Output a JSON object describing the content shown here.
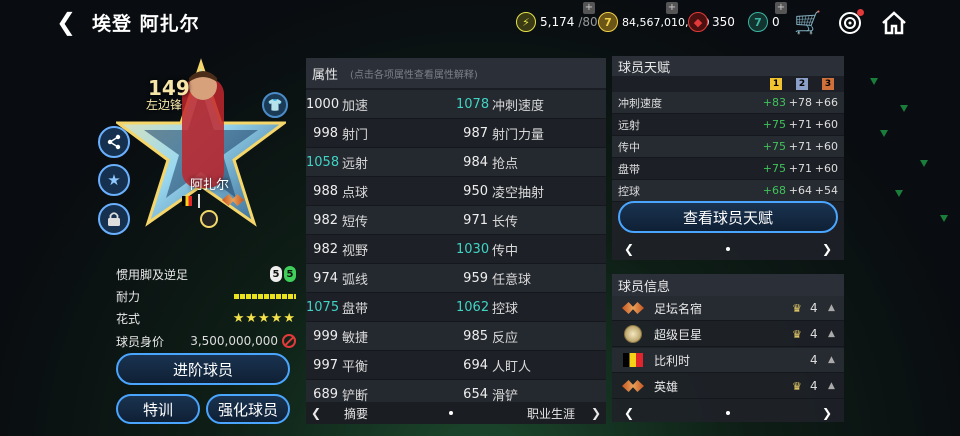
{
  "header": {
    "title": "埃登 阿扎尔",
    "resources": [
      {
        "icon": "energy-icon",
        "value": "5,174",
        "max": "/80",
        "color": "#d6d334"
      },
      {
        "icon": "coin-icon",
        "value": "84,567,010,400",
        "color": "#d8b23a"
      },
      {
        "icon": "gem-icon",
        "value": "350",
        "color": "#d43a3a"
      },
      {
        "icon": "token-icon",
        "value": "0",
        "color": "#3cb4a3"
      }
    ]
  },
  "card": {
    "rating": "149",
    "position": "左边锋",
    "name": "阿扎尔"
  },
  "player_stats": {
    "foot_label": "惯用脚及逆足",
    "foot_left": "5",
    "foot_right": "5",
    "stamina_label": "耐力",
    "skill_label": "花式",
    "skill_stars": "★★★★★",
    "value_label": "球员身价",
    "value": "3,500,000,000"
  },
  "buttons": {
    "advance": "进阶球员",
    "train": "特训",
    "enhance": "强化球员"
  },
  "attributes": {
    "title": "属性",
    "hint": "(点击各项属性查看属性解释)",
    "rows": [
      [
        {
          "v": "1000",
          "n": "加速",
          "hl": false
        },
        {
          "v": "1078",
          "n": "冲刺速度",
          "hl": true
        }
      ],
      [
        {
          "v": "998",
          "n": "射门",
          "hl": false
        },
        {
          "v": "987",
          "n": "射门力量",
          "hl": false
        }
      ],
      [
        {
          "v": "1058",
          "n": "远射",
          "hl": true
        },
        {
          "v": "984",
          "n": "抢点",
          "hl": false
        }
      ],
      [
        {
          "v": "988",
          "n": "点球",
          "hl": false
        },
        {
          "v": "950",
          "n": "凌空抽射",
          "hl": false
        }
      ],
      [
        {
          "v": "982",
          "n": "短传",
          "hl": false
        },
        {
          "v": "971",
          "n": "长传",
          "hl": false
        }
      ],
      [
        {
          "v": "982",
          "n": "视野",
          "hl": false
        },
        {
          "v": "1030",
          "n": "传中",
          "hl": true
        }
      ],
      [
        {
          "v": "974",
          "n": "弧线",
          "hl": false
        },
        {
          "v": "959",
          "n": "任意球",
          "hl": false
        }
      ],
      [
        {
          "v": "1075",
          "n": "盘带",
          "hl": true
        },
        {
          "v": "1062",
          "n": "控球",
          "hl": true
        }
      ],
      [
        {
          "v": "999",
          "n": "敏捷",
          "hl": false
        },
        {
          "v": "985",
          "n": "反应",
          "hl": false
        }
      ],
      [
        {
          "v": "997",
          "n": "平衡",
          "hl": false
        },
        {
          "v": "694",
          "n": "人盯人",
          "hl": false
        }
      ],
      [
        {
          "v": "689",
          "n": "铲断",
          "hl": false
        },
        {
          "v": "654",
          "n": "滑铲",
          "hl": false
        }
      ]
    ],
    "footer_left": "摘要",
    "footer_right": "职业生涯"
  },
  "talent": {
    "title": "球员天赋",
    "levels": [
      "1",
      "2",
      "3"
    ],
    "rows": [
      {
        "n": "冲刺速度",
        "a": "+83",
        "b": "+78",
        "c": "+66"
      },
      {
        "n": "远射",
        "a": "+75",
        "b": "+71",
        "c": "+60"
      },
      {
        "n": "传中",
        "a": "+75",
        "b": "+71",
        "c": "+60"
      },
      {
        "n": "盘带",
        "a": "+75",
        "b": "+71",
        "c": "+60"
      },
      {
        "n": "控球",
        "a": "+68",
        "b": "+64",
        "c": "+54"
      }
    ],
    "button": "查看球员天赋"
  },
  "player_info": {
    "title": "球员信息",
    "rows": [
      {
        "icon": "wings-badge-icon",
        "n": "足坛名宿",
        "lv": "4",
        "crown": true
      },
      {
        "icon": "crest-badge-icon",
        "n": "超级巨星",
        "lv": "4",
        "crown": true
      },
      {
        "icon": "belgium-flag-icon",
        "n": "比利时",
        "lv": "4",
        "crown": false
      },
      {
        "icon": "wings-badge-icon",
        "n": "英雄",
        "lv": "4",
        "crown": true
      }
    ]
  }
}
